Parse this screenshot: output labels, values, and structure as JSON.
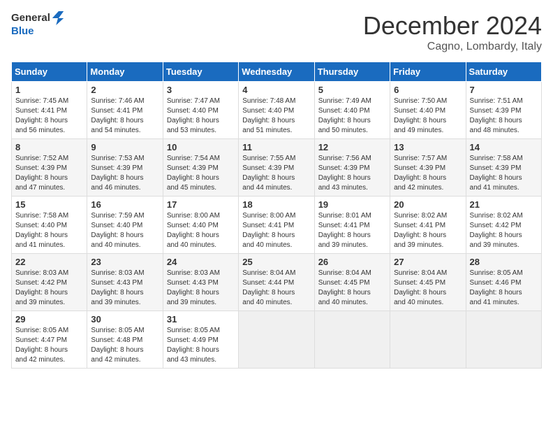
{
  "header": {
    "logo_line1": "General",
    "logo_line2": "Blue",
    "month_title": "December 2024",
    "location": "Cagno, Lombardy, Italy"
  },
  "columns": [
    "Sunday",
    "Monday",
    "Tuesday",
    "Wednesday",
    "Thursday",
    "Friday",
    "Saturday"
  ],
  "weeks": [
    [
      {
        "day": "1",
        "info": "Sunrise: 7:45 AM\nSunset: 4:41 PM\nDaylight: 8 hours\nand 56 minutes."
      },
      {
        "day": "2",
        "info": "Sunrise: 7:46 AM\nSunset: 4:41 PM\nDaylight: 8 hours\nand 54 minutes."
      },
      {
        "day": "3",
        "info": "Sunrise: 7:47 AM\nSunset: 4:40 PM\nDaylight: 8 hours\nand 53 minutes."
      },
      {
        "day": "4",
        "info": "Sunrise: 7:48 AM\nSunset: 4:40 PM\nDaylight: 8 hours\nand 51 minutes."
      },
      {
        "day": "5",
        "info": "Sunrise: 7:49 AM\nSunset: 4:40 PM\nDaylight: 8 hours\nand 50 minutes."
      },
      {
        "day": "6",
        "info": "Sunrise: 7:50 AM\nSunset: 4:40 PM\nDaylight: 8 hours\nand 49 minutes."
      },
      {
        "day": "7",
        "info": "Sunrise: 7:51 AM\nSunset: 4:39 PM\nDaylight: 8 hours\nand 48 minutes."
      }
    ],
    [
      {
        "day": "8",
        "info": "Sunrise: 7:52 AM\nSunset: 4:39 PM\nDaylight: 8 hours\nand 47 minutes."
      },
      {
        "day": "9",
        "info": "Sunrise: 7:53 AM\nSunset: 4:39 PM\nDaylight: 8 hours\nand 46 minutes."
      },
      {
        "day": "10",
        "info": "Sunrise: 7:54 AM\nSunset: 4:39 PM\nDaylight: 8 hours\nand 45 minutes."
      },
      {
        "day": "11",
        "info": "Sunrise: 7:55 AM\nSunset: 4:39 PM\nDaylight: 8 hours\nand 44 minutes."
      },
      {
        "day": "12",
        "info": "Sunrise: 7:56 AM\nSunset: 4:39 PM\nDaylight: 8 hours\nand 43 minutes."
      },
      {
        "day": "13",
        "info": "Sunrise: 7:57 AM\nSunset: 4:39 PM\nDaylight: 8 hours\nand 42 minutes."
      },
      {
        "day": "14",
        "info": "Sunrise: 7:58 AM\nSunset: 4:39 PM\nDaylight: 8 hours\nand 41 minutes."
      }
    ],
    [
      {
        "day": "15",
        "info": "Sunrise: 7:58 AM\nSunset: 4:40 PM\nDaylight: 8 hours\nand 41 minutes."
      },
      {
        "day": "16",
        "info": "Sunrise: 7:59 AM\nSunset: 4:40 PM\nDaylight: 8 hours\nand 40 minutes."
      },
      {
        "day": "17",
        "info": "Sunrise: 8:00 AM\nSunset: 4:40 PM\nDaylight: 8 hours\nand 40 minutes."
      },
      {
        "day": "18",
        "info": "Sunrise: 8:00 AM\nSunset: 4:41 PM\nDaylight: 8 hours\nand 40 minutes."
      },
      {
        "day": "19",
        "info": "Sunrise: 8:01 AM\nSunset: 4:41 PM\nDaylight: 8 hours\nand 39 minutes."
      },
      {
        "day": "20",
        "info": "Sunrise: 8:02 AM\nSunset: 4:41 PM\nDaylight: 8 hours\nand 39 minutes."
      },
      {
        "day": "21",
        "info": "Sunrise: 8:02 AM\nSunset: 4:42 PM\nDaylight: 8 hours\nand 39 minutes."
      }
    ],
    [
      {
        "day": "22",
        "info": "Sunrise: 8:03 AM\nSunset: 4:42 PM\nDaylight: 8 hours\nand 39 minutes."
      },
      {
        "day": "23",
        "info": "Sunrise: 8:03 AM\nSunset: 4:43 PM\nDaylight: 8 hours\nand 39 minutes."
      },
      {
        "day": "24",
        "info": "Sunrise: 8:03 AM\nSunset: 4:43 PM\nDaylight: 8 hours\nand 39 minutes."
      },
      {
        "day": "25",
        "info": "Sunrise: 8:04 AM\nSunset: 4:44 PM\nDaylight: 8 hours\nand 40 minutes."
      },
      {
        "day": "26",
        "info": "Sunrise: 8:04 AM\nSunset: 4:45 PM\nDaylight: 8 hours\nand 40 minutes."
      },
      {
        "day": "27",
        "info": "Sunrise: 8:04 AM\nSunset: 4:45 PM\nDaylight: 8 hours\nand 40 minutes."
      },
      {
        "day": "28",
        "info": "Sunrise: 8:05 AM\nSunset: 4:46 PM\nDaylight: 8 hours\nand 41 minutes."
      }
    ],
    [
      {
        "day": "29",
        "info": "Sunrise: 8:05 AM\nSunset: 4:47 PM\nDaylight: 8 hours\nand 42 minutes."
      },
      {
        "day": "30",
        "info": "Sunrise: 8:05 AM\nSunset: 4:48 PM\nDaylight: 8 hours\nand 42 minutes."
      },
      {
        "day": "31",
        "info": "Sunrise: 8:05 AM\nSunset: 4:49 PM\nDaylight: 8 hours\nand 43 minutes."
      },
      {
        "day": "",
        "info": ""
      },
      {
        "day": "",
        "info": ""
      },
      {
        "day": "",
        "info": ""
      },
      {
        "day": "",
        "info": ""
      }
    ]
  ]
}
